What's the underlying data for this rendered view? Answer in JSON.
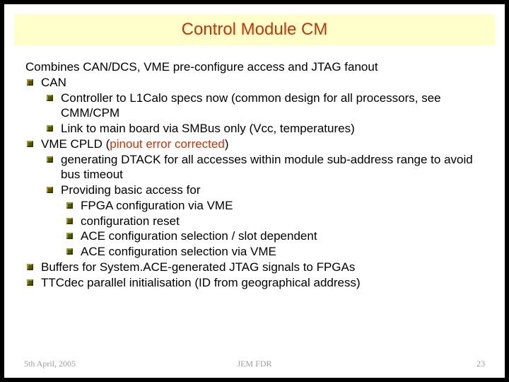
{
  "title": "Control Module CM",
  "intro": "Combines CAN/DCS, VME pre-configure access and JTAG fanout",
  "items": [
    {
      "label": "CAN",
      "children": [
        {
          "label": "Controller to L1Calo specs now (common design for all processors, see CMM/CPM"
        },
        {
          "label": "Link to main board via SMBus only (Vcc, temperatures)"
        }
      ]
    },
    {
      "label_pre": "VME CPLD (",
      "label_pin": "pinout error corrected",
      "label_post": ")",
      "children": [
        {
          "label": " generating DTACK for all accesses within module sub-address range to avoid bus timeout"
        },
        {
          "label": "Providing basic access for",
          "children": [
            {
              "label": "FPGA configuration via VME"
            },
            {
              "label": "configuration reset"
            },
            {
              "label": "ACE configuration selection / slot dependent"
            },
            {
              "label": "ACE configuration selection via VME"
            }
          ]
        }
      ]
    },
    {
      "label": "Buffers for System.ACE-generated JTAG signals to FPGAs"
    },
    {
      "label": "TTCdec parallel initialisation (ID from geographical address)"
    }
  ],
  "footer": {
    "date": "5th April, 2005",
    "label": "JEM FDR",
    "page": "23"
  }
}
